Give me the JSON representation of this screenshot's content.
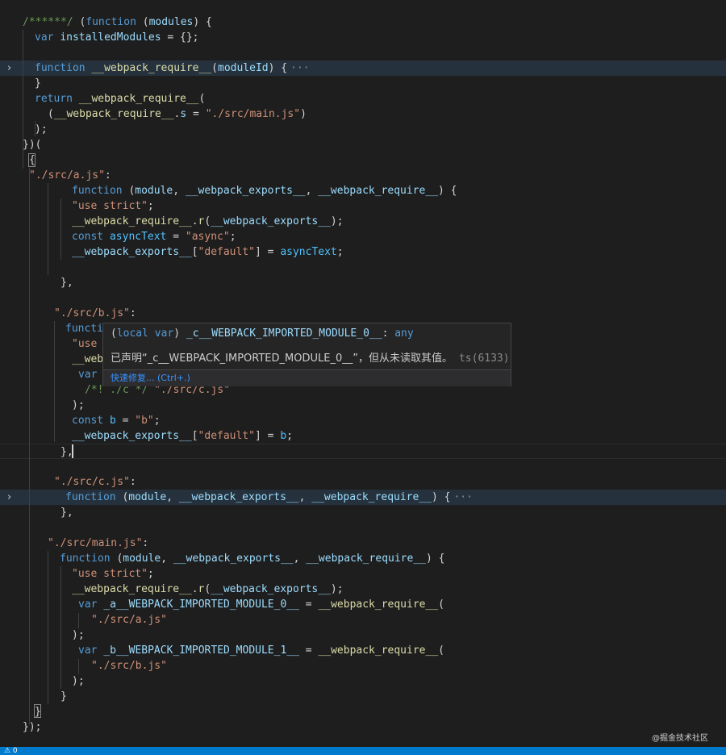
{
  "editor": {
    "lines": [
      [
        [
          "c",
          "/******/"
        ],
        [
          "p",
          " ("
        ],
        [
          "k",
          "function"
        ],
        [
          "p",
          " ("
        ],
        [
          "v",
          "modules"
        ],
        [
          "p",
          ") {"
        ]
      ],
      [
        [
          "k",
          "var"
        ],
        [
          "p",
          " "
        ],
        [
          "v",
          "installedModules"
        ],
        [
          "p",
          " = {};"
        ]
      ],
      [],
      [
        [
          "k",
          "function"
        ],
        [
          "p",
          " "
        ],
        [
          "f",
          "__webpack_require__"
        ],
        [
          "p",
          "("
        ],
        [
          "v",
          "moduleId"
        ],
        [
          "p",
          ") {"
        ]
      ],
      [
        [
          "p",
          "}"
        ]
      ],
      [
        [
          "k",
          "return"
        ],
        [
          "p",
          " "
        ],
        [
          "f",
          "__webpack_require__"
        ],
        [
          "p",
          "("
        ]
      ],
      [
        [
          "p",
          "("
        ],
        [
          "f",
          "__webpack_require__"
        ],
        [
          "p",
          "."
        ],
        [
          "v",
          "s"
        ],
        [
          "p",
          " = "
        ],
        [
          "s",
          "\"./src/main.js\""
        ],
        [
          "p",
          ")"
        ]
      ],
      [
        [
          "p",
          ");"
        ]
      ],
      [
        [
          "p",
          "})("
        ]
      ],
      [
        [
          "p",
          "{"
        ]
      ],
      [
        [
          "s",
          "\"./src/a.js\""
        ],
        [
          "p",
          ":"
        ]
      ],
      [
        [
          "k",
          "function"
        ],
        [
          "p",
          " ("
        ],
        [
          "v",
          "module"
        ],
        [
          "p",
          ", "
        ],
        [
          "v",
          "__webpack_exports__"
        ],
        [
          "p",
          ", "
        ],
        [
          "v",
          "__webpack_require__"
        ],
        [
          "p",
          ") {"
        ]
      ],
      [
        [
          "s",
          "\"use strict\""
        ],
        [
          "p",
          ";"
        ]
      ],
      [
        [
          "f",
          "__webpack_require__"
        ],
        [
          "p",
          "."
        ],
        [
          "f",
          "r"
        ],
        [
          "p",
          "("
        ],
        [
          "v",
          "__webpack_exports__"
        ],
        [
          "p",
          ");"
        ]
      ],
      [
        [
          "k",
          "const"
        ],
        [
          "p",
          " "
        ],
        [
          "cn",
          "asyncText"
        ],
        [
          "p",
          " = "
        ],
        [
          "s",
          "\"async\""
        ],
        [
          "p",
          ";"
        ]
      ],
      [
        [
          "v",
          "__webpack_exports__"
        ],
        [
          "p",
          "["
        ],
        [
          "s",
          "\"default\""
        ],
        [
          "p",
          "] = "
        ],
        [
          "cn",
          "asyncText"
        ],
        [
          "p",
          ";"
        ]
      ],
      [],
      [
        [
          "p",
          "},"
        ]
      ],
      [],
      [
        [
          "s",
          "\"./src/b.js\""
        ],
        [
          "p",
          ":"
        ]
      ],
      [
        [
          "k",
          "function"
        ]
      ],
      [
        [
          "s",
          "\"use"
        ]
      ],
      [
        [
          "f",
          "__web"
        ]
      ],
      [
        [
          "k",
          "var"
        ]
      ],
      [
        [
          "c",
          "/*! ./c */"
        ],
        [
          "p",
          " "
        ],
        [
          "s",
          "\"./src/c.js\""
        ]
      ],
      [
        [
          "p",
          ");"
        ]
      ],
      [
        [
          "k",
          "const"
        ],
        [
          "p",
          " "
        ],
        [
          "cn",
          "b"
        ],
        [
          "p",
          " = "
        ],
        [
          "s",
          "\"b\""
        ],
        [
          "p",
          ";"
        ]
      ],
      [
        [
          "v",
          "__webpack_exports__"
        ],
        [
          "p",
          "["
        ],
        [
          "s",
          "\"default\""
        ],
        [
          "p",
          "] = "
        ],
        [
          "cn",
          "b"
        ],
        [
          "p",
          ";"
        ]
      ],
      [
        [
          "p",
          "},"
        ]
      ],
      [],
      [
        [
          "s",
          "\"./src/c.js\""
        ],
        [
          "p",
          ":"
        ]
      ],
      [
        [
          "k",
          "function"
        ],
        [
          "p",
          " ("
        ],
        [
          "v",
          "module"
        ],
        [
          "p",
          ", "
        ],
        [
          "v",
          "__webpack_exports__"
        ],
        [
          "p",
          ", "
        ],
        [
          "v",
          "__webpack_require__"
        ],
        [
          "p",
          ") {"
        ]
      ],
      [
        [
          "p",
          "},"
        ]
      ],
      [],
      [
        [
          "s",
          "\"./src/main.js\""
        ],
        [
          "p",
          ":"
        ]
      ],
      [
        [
          "k",
          "function"
        ],
        [
          "p",
          " ("
        ],
        [
          "v",
          "module"
        ],
        [
          "p",
          ", "
        ],
        [
          "v",
          "__webpack_exports__"
        ],
        [
          "p",
          ", "
        ],
        [
          "v",
          "__webpack_require__"
        ],
        [
          "p",
          ") {"
        ]
      ],
      [
        [
          "s",
          "\"use strict\""
        ],
        [
          "p",
          ";"
        ]
      ],
      [
        [
          "f",
          "__webpack_require__"
        ],
        [
          "p",
          "."
        ],
        [
          "f",
          "r"
        ],
        [
          "p",
          "("
        ],
        [
          "v",
          "__webpack_exports__"
        ],
        [
          "p",
          ");"
        ]
      ],
      [
        [
          "k",
          "var"
        ],
        [
          "p",
          " "
        ],
        [
          "v",
          "_a__WEBPACK_IMPORTED_MODULE_0__"
        ],
        [
          "p",
          " = "
        ],
        [
          "f",
          "__webpack_require__"
        ],
        [
          "p",
          "("
        ]
      ],
      [
        [
          "s",
          "\"./src/a.js\""
        ]
      ],
      [
        [
          "p",
          ");"
        ]
      ],
      [
        [
          "k",
          "var"
        ],
        [
          "p",
          " "
        ],
        [
          "v",
          "_b__WEBPACK_IMPORTED_MODULE_1__"
        ],
        [
          "p",
          " = "
        ],
        [
          "f",
          "__webpack_require__"
        ],
        [
          "p",
          "("
        ]
      ],
      [
        [
          "s",
          "\"./src/b.js\""
        ]
      ],
      [
        [
          "p",
          ");"
        ]
      ],
      [
        [
          "p",
          "}"
        ]
      ],
      [
        [
          "p",
          "}"
        ]
      ],
      [
        [
          "p",
          "});"
        ]
      ]
    ],
    "folded_marker": "···"
  },
  "hover": {
    "signature": [
      [
        "p",
        "("
      ],
      [
        "k",
        "local var"
      ],
      [
        "p",
        ") "
      ],
      [
        "v",
        "_c__WEBPACK_IMPORTED_MODULE_0__"
      ],
      [
        "p",
        ": "
      ],
      [
        "k",
        "any"
      ]
    ],
    "message": "已声明“_c__WEBPACK_IMPORTED_MODULE_0__”，但从未读取其值。",
    "code": "ts(6133)",
    "quick_fix": "快速修复... (Ctrl+.)"
  },
  "watermark": "@掘金技术社区",
  "statusbar": {
    "left": "⚠ 0"
  },
  "colors": {
    "background": "#1e1e1e",
    "keyword": "#569cd6",
    "function": "#dcdcaa",
    "variable": "#9cdcfe",
    "string": "#ce9178",
    "comment": "#6a9955",
    "constant": "#4fc1ff",
    "statusbar": "#007acc",
    "link": "#3794ff"
  }
}
